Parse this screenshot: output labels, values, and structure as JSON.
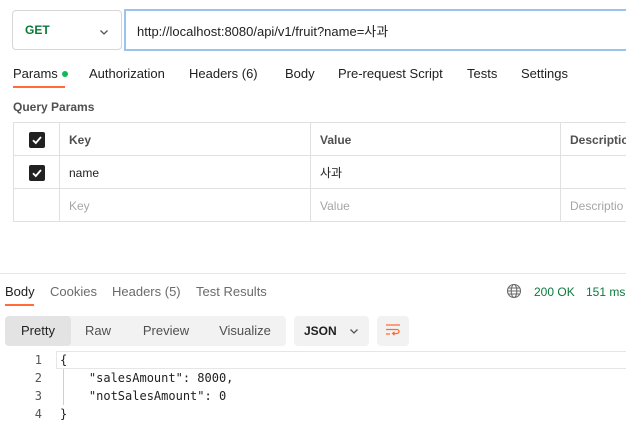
{
  "request": {
    "method": "GET",
    "url": "http://localhost:8080/api/v1/fruit?name=사과"
  },
  "request_tabs": [
    {
      "label": "Params"
    },
    {
      "label": "Authorization"
    },
    {
      "label": "Headers (6)"
    },
    {
      "label": "Body"
    },
    {
      "label": "Pre-request Script"
    },
    {
      "label": "Tests"
    },
    {
      "label": "Settings"
    }
  ],
  "query_params": {
    "title": "Query Params",
    "columns": [
      "Key",
      "Value",
      "Descriptio"
    ],
    "rows": [
      {
        "checked": true,
        "key": "name",
        "value": "사과",
        "description": ""
      }
    ],
    "placeholder": {
      "key": "Key",
      "value": "Value",
      "description": "Descriptio"
    }
  },
  "response_tabs": [
    {
      "label": "Body"
    },
    {
      "label": "Cookies"
    },
    {
      "label": "Headers (5)"
    },
    {
      "label": "Test Results"
    }
  ],
  "response_meta": {
    "status": "200 OK",
    "time": "151 ms"
  },
  "view_modes": [
    "Pretty",
    "Raw",
    "Preview",
    "Visualize"
  ],
  "format": "JSON",
  "code_lines": [
    {
      "num": "1",
      "text": "{"
    },
    {
      "num": "2",
      "text": "    \"salesAmount\": 8000,"
    },
    {
      "num": "3",
      "text": "    \"notSalesAmount\": 0"
    },
    {
      "num": "4",
      "text": "}"
    }
  ],
  "colors": {
    "accent": "#ff6c37",
    "success": "#0a7a3a",
    "active_dot": "#0cbb52",
    "url_focus": "#9bc3f0"
  },
  "icons": [
    "chevron-down-icon",
    "checkbox-checked-icon",
    "globe-icon",
    "wrap-lines-icon"
  ]
}
